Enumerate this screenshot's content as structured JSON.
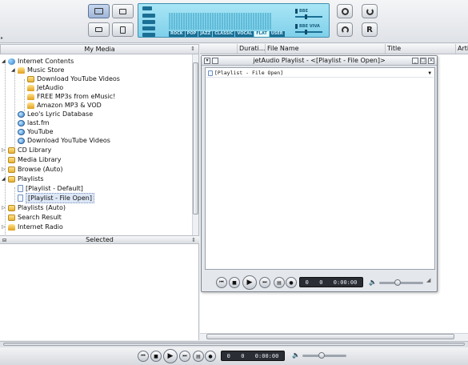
{
  "toolbar": {
    "left_buttons": [
      "layout-icon",
      "window-icon",
      "mini-player-icon",
      "calculator-icon"
    ],
    "right_buttons": [
      "record-icon",
      "power-icon",
      "repeat-icon",
      "r-icon"
    ],
    "r_label": "R"
  },
  "lcd": {
    "presets": [
      "ROCK",
      "POP",
      "JAZZ",
      "CLASSIC",
      "VOCAL",
      "FLAT",
      "USER"
    ],
    "selected_preset": "FLAT",
    "bass_label": "BBE",
    "viva_label": "BBE VIVA"
  },
  "left_panel": {
    "header": "My Media",
    "selected_header": "Selected",
    "tree": [
      {
        "label": "Internet Contents",
        "level": 0,
        "icon": "globe",
        "expander": "open"
      },
      {
        "label": "Music Store",
        "level": 1,
        "icon": "cart",
        "expander": "open"
      },
      {
        "label": "Download YouTube Videos",
        "level": 2,
        "icon": "folder"
      },
      {
        "label": "JetAudio",
        "level": 2,
        "icon": "cart"
      },
      {
        "label": "FREE MP3s from eMusic!",
        "level": 2,
        "icon": "cart"
      },
      {
        "label": "Amazon MP3 & VOD",
        "level": 2,
        "icon": "cart"
      },
      {
        "label": "Leo's Lyric Database",
        "level": 1,
        "icon": "gglobe"
      },
      {
        "label": "last.fm",
        "level": 1,
        "icon": "gglobe"
      },
      {
        "label": "YouTube",
        "level": 1,
        "icon": "gglobe"
      },
      {
        "label": "Download YouTube Videos",
        "level": 1,
        "icon": "gglobe"
      },
      {
        "label": "CD Library",
        "level": 0,
        "icon": "folder",
        "expander": "closed"
      },
      {
        "label": "Media Library",
        "level": 0,
        "icon": "folder"
      },
      {
        "label": "Browse (Auto)",
        "level": 0,
        "icon": "folder",
        "expander": "closed"
      },
      {
        "label": "Playlists",
        "level": 0,
        "icon": "folder",
        "expander": "open"
      },
      {
        "label": "[Playlist - Default]",
        "level": 1,
        "icon": "doc"
      },
      {
        "label": "[Playlist - File Open]",
        "level": 1,
        "icon": "doc",
        "selected": true
      },
      {
        "label": "Playlists (Auto)",
        "level": 0,
        "icon": "folder",
        "expander": "closed"
      },
      {
        "label": "Search Result",
        "level": 0,
        "icon": "folder"
      },
      {
        "label": "Internet Radio",
        "level": 0,
        "icon": "cart",
        "expander": "closed"
      }
    ]
  },
  "columns": [
    "Durati...",
    "File Name",
    "Title",
    "Arti"
  ],
  "playlist_window": {
    "title": "jetAudio Playlist - <[Playlist - File Open]>",
    "dropdown_value": "[Playlist - File Open]",
    "time": {
      "a": "0",
      "b": "0",
      "clock": "0:00:00"
    }
  },
  "bottom_player": {
    "time": {
      "a": "0",
      "b": "0",
      "clock": "0:00:00"
    },
    "volume": 0.45
  }
}
